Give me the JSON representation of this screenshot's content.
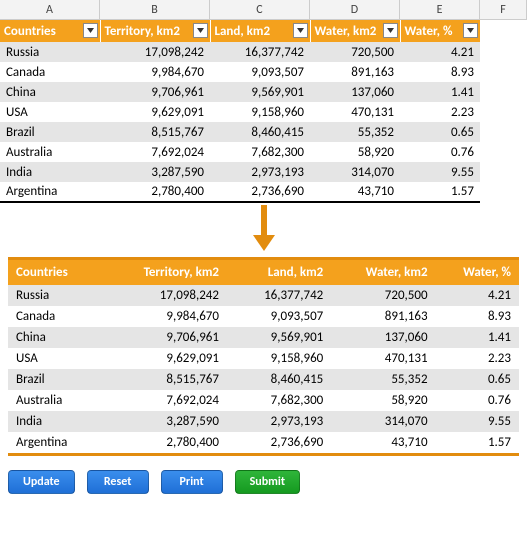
{
  "columns": [
    "A",
    "B",
    "C",
    "D",
    "E",
    "F"
  ],
  "table1": {
    "headers": [
      "Countries",
      "Territory, km2",
      "Land, km2",
      "Water, km2",
      "Water, %"
    ],
    "rows": [
      {
        "country": "Russia",
        "territory": "17,098,242",
        "land": "16,377,742",
        "water": "720,500",
        "pct": "4.21"
      },
      {
        "country": "Canada",
        "territory": "9,984,670",
        "land": "9,093,507",
        "water": "891,163",
        "pct": "8.93"
      },
      {
        "country": "China",
        "territory": "9,706,961",
        "land": "9,569,901",
        "water": "137,060",
        "pct": "1.41"
      },
      {
        "country": "USA",
        "territory": "9,629,091",
        "land": "9,158,960",
        "water": "470,131",
        "pct": "2.23"
      },
      {
        "country": "Brazil",
        "territory": "8,515,767",
        "land": "8,460,415",
        "water": "55,352",
        "pct": "0.65"
      },
      {
        "country": "Australia",
        "territory": "7,692,024",
        "land": "7,682,300",
        "water": "58,920",
        "pct": "0.76"
      },
      {
        "country": "India",
        "territory": "3,287,590",
        "land": "2,973,193",
        "water": "314,070",
        "pct": "9.55"
      },
      {
        "country": "Argentina",
        "territory": "2,780,400",
        "land": "2,736,690",
        "water": "43,710",
        "pct": "1.57"
      }
    ]
  },
  "table2": {
    "headers": [
      "Countries",
      "Territory, km2",
      "Land, km2",
      "Water, km2",
      "Water, %"
    ],
    "rows": [
      {
        "country": "Russia",
        "territory": "17,098,242",
        "land": "16,377,742",
        "water": "720,500",
        "pct": "4.21"
      },
      {
        "country": "Canada",
        "territory": "9,984,670",
        "land": "9,093,507",
        "water": "891,163",
        "pct": "8.93"
      },
      {
        "country": "China",
        "territory": "9,706,961",
        "land": "9,569,901",
        "water": "137,060",
        "pct": "1.41"
      },
      {
        "country": "USA",
        "territory": "9,629,091",
        "land": "9,158,960",
        "water": "470,131",
        "pct": "2.23"
      },
      {
        "country": "Brazil",
        "territory": "8,515,767",
        "land": "8,460,415",
        "water": "55,352",
        "pct": "0.65"
      },
      {
        "country": "Australia",
        "territory": "7,692,024",
        "land": "7,682,300",
        "water": "58,920",
        "pct": "0.76"
      },
      {
        "country": "India",
        "territory": "3,287,590",
        "land": "2,973,193",
        "water": "314,070",
        "pct": "9.55"
      },
      {
        "country": "Argentina",
        "territory": "2,780,400",
        "land": "2,736,690",
        "water": "43,710",
        "pct": "1.57"
      }
    ]
  },
  "buttons": {
    "update": "Update",
    "reset": "Reset",
    "print": "Print",
    "submit": "Submit"
  }
}
